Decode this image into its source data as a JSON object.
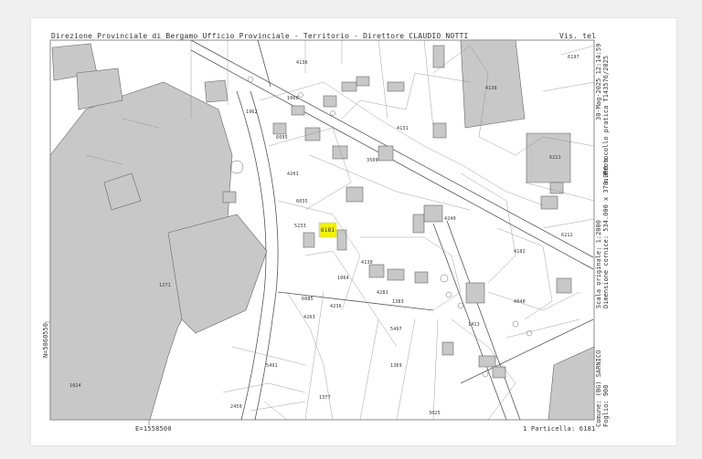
{
  "header": {
    "left": "Direzione Provinciale di Bergamo  Ufficio Provinciale - Territorio - Direttore CLAUDIO NOTTI",
    "right": "Vis. tel"
  },
  "side_right": {
    "date": "30-Mag-2025 12:14:59",
    "protocol": "m.Protocollo pratica T143576/2025",
    "scale": "Scala originale: 1:2000",
    "dimension": "Dimensione cornice: 534.000 x 378.000 m",
    "comune": "Comune: (BG) SARNICO",
    "foglio": "Foglio: 908"
  },
  "coords": {
    "north": "N=5060550",
    "east": "E=1558500"
  },
  "footer": {
    "particella": "1 Particella: 6181"
  },
  "highlight": {
    "label": "6181",
    "color": "#f2f200"
  },
  "parcel_labels": [
    "6197",
    "4136",
    "2020",
    "1060",
    "4135",
    "4138",
    "1964",
    "4300",
    "1962",
    "1982",
    "3880",
    "6211",
    "4201",
    "3500",
    "1961",
    "4120",
    "4131",
    "4132",
    "6089",
    "4240",
    "6095",
    "5008",
    "6035",
    "4182",
    "4130",
    "1064",
    "4040",
    "6085",
    "1383",
    "4281",
    "4236",
    "1373",
    "5491",
    "4210",
    "1388",
    "5497",
    "1377",
    "4219",
    "5233",
    "6232",
    "6290",
    "4243",
    "5427",
    "1369",
    "4202",
    "6210",
    "1332",
    "6207",
    "6217",
    "1271",
    "4264",
    "1375",
    "1374",
    "1372",
    "6088",
    "4258",
    "6234",
    "4203",
    "2050",
    "1412",
    "1413",
    "1962",
    "6156",
    "5023",
    "1393",
    "1376",
    "4135",
    "5015",
    "1024",
    "2113",
    "1341",
    "3025",
    "2450",
    "6212"
  ]
}
